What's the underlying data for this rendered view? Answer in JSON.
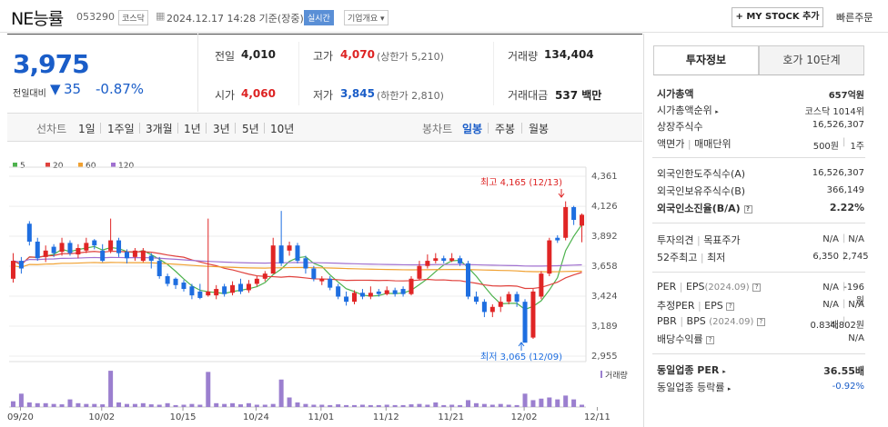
{
  "header": {
    "stock_name": "NE능률",
    "stock_code": "053290",
    "market_badge": "코스닥",
    "timestamp": "2024.12.17 14:28 기준(장중)",
    "realtime_badge": "실시간",
    "company_overview": "기업개요",
    "mystock_button": "+ MY STOCK 추가",
    "quick_order": "빠른주문"
  },
  "quote": {
    "price": "3,975",
    "change_label": "전일대비",
    "change_value": "35",
    "change_pct": "-0.87%",
    "prev_label": "전일",
    "prev_value": "4,010",
    "high_label": "고가",
    "high_value": "4,070",
    "upper_limit": "(상한가 5,210)",
    "volume_label": "거래량",
    "volume_value": "134,404",
    "open_label": "시가",
    "open_value": "4,060",
    "low_label": "저가",
    "low_value": "3,845",
    "lower_limit": "(하한가 2,810)",
    "amount_label": "거래대금",
    "amount_value": "537 백만"
  },
  "chart_nav": {
    "line_chart": "선차트",
    "periods": [
      "1일",
      "1주일",
      "3개월",
      "1년",
      "3년",
      "5년",
      "10년"
    ],
    "candle_chart": "봉차트",
    "candle_periods": [
      "일봉",
      "주봉",
      "월봉"
    ]
  },
  "chart_data": {
    "type": "candlestick",
    "legend": [
      "5",
      "20",
      "60",
      "120"
    ],
    "ma_colors": [
      "#4db24d",
      "#e0413c",
      "#f0a030",
      "#a070d0"
    ],
    "y_ticks": [
      "4,361",
      "4,126",
      "3,892",
      "3,658",
      "3,424",
      "3,189",
      "2,955"
    ],
    "ylim": [
      2955,
      4361
    ],
    "x_ticks": [
      "09/20",
      "10/02",
      "10/15",
      "10/24",
      "11/01",
      "11/12",
      "11/21",
      "12/02",
      "12/11"
    ],
    "high_annotation": "최고 4,165 (12/13)",
    "low_annotation": "최저 3,065 (12/09)",
    "volume_label": "거래량",
    "candles": [
      [
        3700,
        3560,
        3760,
        3530
      ],
      [
        3640,
        3700,
        3730,
        3600
      ],
      [
        3850,
        3990,
        4010,
        3820
      ],
      [
        3720,
        3850,
        3880,
        3700
      ],
      [
        3780,
        3730,
        3820,
        3690
      ],
      [
        3760,
        3810,
        3830,
        3730
      ],
      [
        3840,
        3770,
        3880,
        3740
      ],
      [
        3760,
        3840,
        3860,
        3740
      ],
      [
        3800,
        3750,
        3830,
        3720
      ],
      [
        3840,
        3780,
        3880,
        3760
      ],
      [
        3820,
        3860,
        3870,
        3790
      ],
      [
        3700,
        3780,
        3830,
        3690
      ],
      [
        3860,
        3780,
        4030,
        3760
      ],
      [
        3760,
        3860,
        3880,
        3730
      ],
      [
        3720,
        3770,
        3790,
        3680
      ],
      [
        3780,
        3730,
        3800,
        3700
      ],
      [
        3780,
        3700,
        3800,
        3690
      ],
      [
        3700,
        3740,
        3760,
        3640
      ],
      [
        3580,
        3700,
        3730,
        3560
      ],
      [
        3520,
        3580,
        3600,
        3500
      ],
      [
        3510,
        3560,
        3570,
        3480
      ],
      [
        3480,
        3530,
        3550,
        3460
      ],
      [
        3430,
        3500,
        3520,
        3400
      ],
      [
        3410,
        3460,
        3520,
        3400
      ],
      [
        3460,
        3430,
        4030,
        3420
      ],
      [
        3480,
        3430,
        3510,
        3400
      ],
      [
        3440,
        3500,
        3520,
        3420
      ],
      [
        3510,
        3450,
        3540,
        3430
      ],
      [
        3460,
        3520,
        3560,
        3440
      ],
      [
        3520,
        3470,
        3550,
        3450
      ],
      [
        3560,
        3520,
        3580,
        3500
      ],
      [
        3600,
        3560,
        3620,
        3540
      ],
      [
        3820,
        3600,
        3880,
        3600
      ],
      [
        3680,
        3820,
        4090,
        3660
      ],
      [
        3820,
        3780,
        3850,
        3740
      ],
      [
        3700,
        3820,
        3840,
        3680
      ],
      [
        3640,
        3720,
        3740,
        3600
      ],
      [
        3560,
        3640,
        3660,
        3540
      ],
      [
        3560,
        3540,
        3580,
        3510
      ],
      [
        3490,
        3560,
        3580,
        3470
      ],
      [
        3420,
        3500,
        3520,
        3400
      ],
      [
        3380,
        3420,
        3460,
        3350
      ],
      [
        3450,
        3380,
        3470,
        3360
      ],
      [
        3420,
        3450,
        3480,
        3400
      ],
      [
        3450,
        3420,
        3500,
        3400
      ],
      [
        3440,
        3460,
        3480,
        3420
      ],
      [
        3470,
        3440,
        3500,
        3430
      ],
      [
        3440,
        3470,
        3490,
        3420
      ],
      [
        3440,
        3480,
        3500,
        3420
      ],
      [
        3560,
        3440,
        3580,
        3430
      ],
      [
        3660,
        3560,
        3700,
        3550
      ],
      [
        3700,
        3660,
        3750,
        3640
      ],
      [
        3720,
        3700,
        3760,
        3680
      ],
      [
        3700,
        3720,
        3740,
        3680
      ],
      [
        3720,
        3700,
        3760,
        3690
      ],
      [
        3680,
        3720,
        3740,
        3660
      ],
      [
        3420,
        3680,
        3700,
        3400
      ],
      [
        3380,
        3420,
        3460,
        3360
      ],
      [
        3300,
        3380,
        3400,
        3260
      ],
      [
        3340,
        3300,
        3360,
        3260
      ],
      [
        3380,
        3340,
        3420,
        3300
      ],
      [
        3440,
        3380,
        3460,
        3360
      ],
      [
        3380,
        3440,
        3460,
        3340
      ],
      [
        3060,
        3380,
        3400,
        3065
      ],
      [
        3460,
        3100,
        3480,
        3090
      ],
      [
        3600,
        3420,
        3620,
        3400
      ],
      [
        3860,
        3600,
        3880,
        3580
      ],
      [
        3860,
        3880,
        3900,
        3840
      ],
      [
        4120,
        3880,
        4165,
        3860
      ],
      [
        4020,
        4120,
        4130,
        3980
      ],
      [
        4060,
        3975,
        4070,
        3845
      ]
    ],
    "volumes": [
      0.15,
      0.35,
      0.12,
      0.1,
      0.1,
      0.08,
      0.07,
      0.2,
      0.1,
      0.08,
      0.08,
      0.07,
      0.95,
      0.12,
      0.08,
      0.08,
      0.1,
      0.07,
      0.06,
      0.1,
      0.05,
      0.06,
      0.08,
      0.06,
      0.92,
      0.1,
      0.08,
      0.1,
      0.07,
      0.1,
      0.06,
      0.06,
      0.08,
      0.72,
      0.25,
      0.12,
      0.08,
      0.06,
      0.06,
      0.05,
      0.07,
      0.05,
      0.05,
      0.06,
      0.05,
      0.05,
      0.06,
      0.05,
      0.05,
      0.07,
      0.08,
      0.06,
      0.12,
      0.05,
      0.06,
      0.05,
      0.18,
      0.1,
      0.08,
      0.06,
      0.08,
      0.06,
      0.05,
      0.35,
      0.18,
      0.22,
      0.25,
      0.2,
      0.3,
      0.2,
      0.06
    ]
  },
  "invest": {
    "tab_info": "투자정보",
    "tab_hoga": "호가 10단계",
    "market_cap_label": "시가총액",
    "market_cap_value": "657억원",
    "rank_label": "시가총액순위",
    "rank_value": "코스닥 1014위",
    "listed_label": "상장주식수",
    "listed_value": "16,526,307",
    "par_label": "액면가",
    "par_sep": "매매단위",
    "par_value": "500원",
    "unit_value": "1주",
    "foreign_limit_label": "외국인한도주식수(A)",
    "foreign_limit_value": "16,526,307",
    "foreign_hold_label": "외국인보유주식수(B)",
    "foreign_hold_value": "366,149",
    "foreign_rate_label": "외국인소진율(B/A)",
    "foreign_rate_value": "2.22%",
    "opinion_label": "투자의견",
    "target_label": "목표주가",
    "opinion_value": "N/A",
    "target_value": "N/A",
    "w52_high_label": "52주최고",
    "w52_low_label": "최저",
    "w52_high_value": "6,350",
    "w52_low_value": "2,745",
    "per_label": "PER",
    "eps_label": "EPS",
    "eps_period": "(2024.09)",
    "per_value": "N/A",
    "eps_value": "-196원",
    "est_per_label": "추정PER",
    "est_eps_label": "EPS",
    "est_per_value": "N/A",
    "est_eps_value": "N/A",
    "pbr_label": "PBR",
    "bps_label": "BPS",
    "bps_period": "(2024.09)",
    "pbr_value": "0.83배",
    "bps_value": "4,802원",
    "div_label": "배당수익률",
    "div_value": "N/A",
    "sector_per_label": "동일업종 PER",
    "sector_per_value": "36.55배",
    "sector_rate_label": "동일업종 등락률",
    "sector_rate_value": "-0.92%"
  }
}
